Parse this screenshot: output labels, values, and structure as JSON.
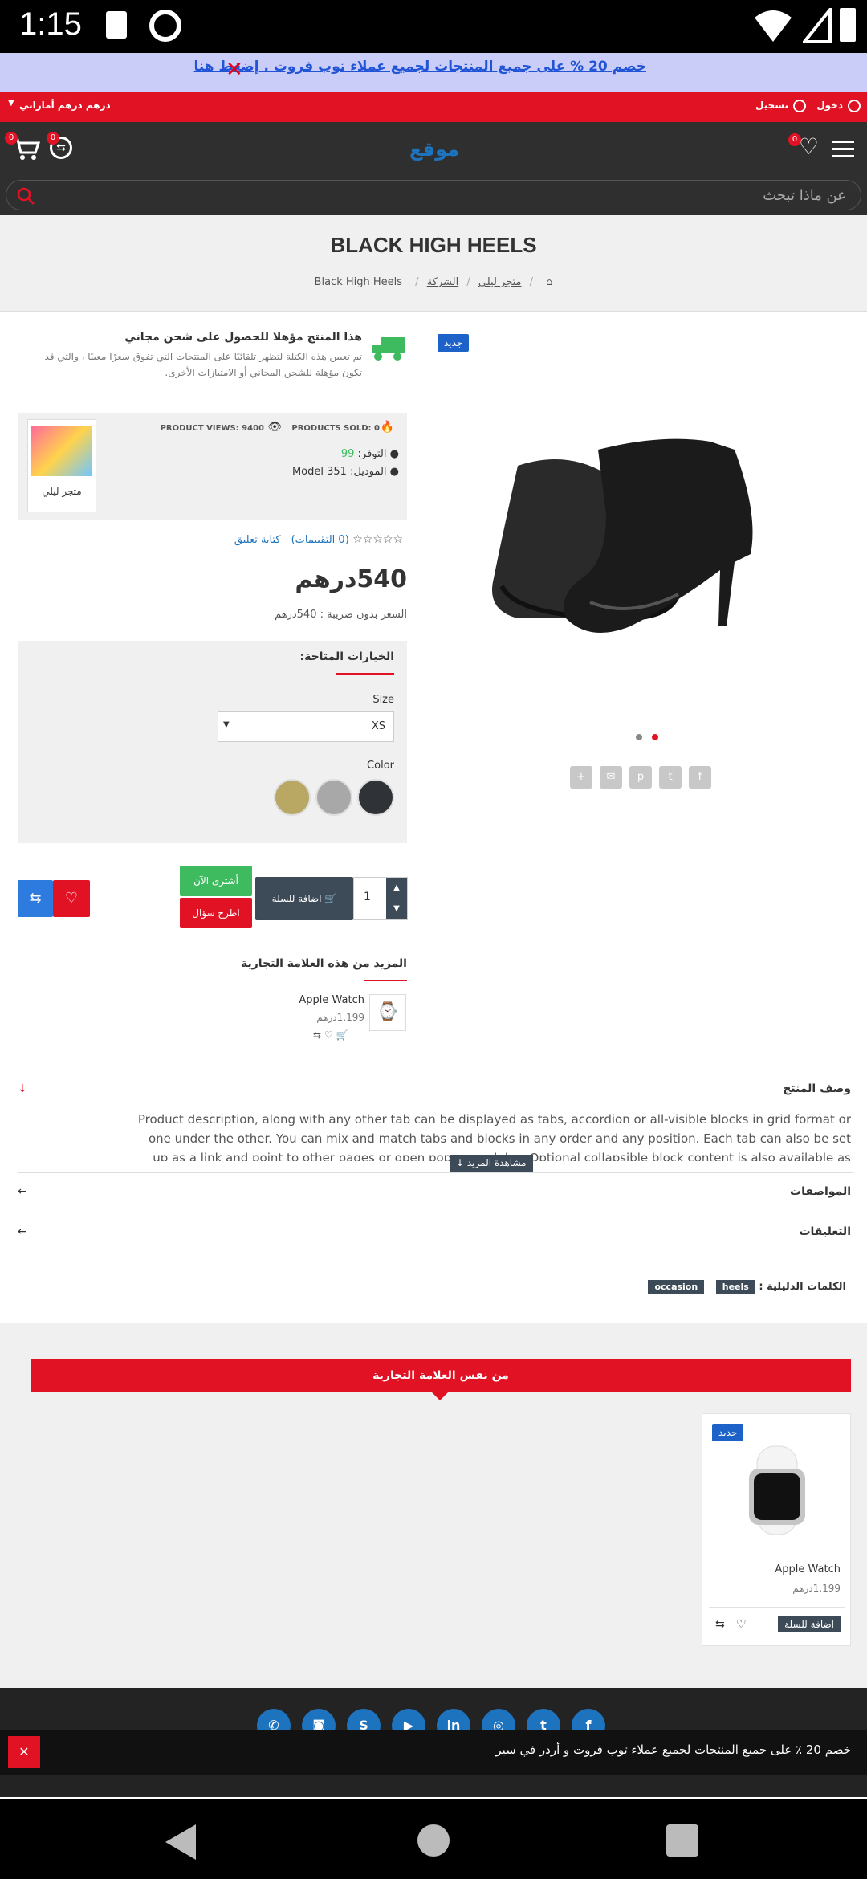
{
  "status_bar": {
    "time": "1:15"
  },
  "promo_bar": {
    "text": "خصم 20 % على جميع المنتجات لجميع عملاء توب فروت . إضغط هنا"
  },
  "top_bar": {
    "login": "دخول",
    "register": "تسجيل",
    "currency": "درهم درهم أماراتي"
  },
  "header": {
    "logo_text": "موقع",
    "wishlist_count": "0",
    "cart_count": "0",
    "compare_count": "0"
  },
  "search": {
    "placeholder": "عن ماذا تبحث"
  },
  "page": {
    "title": "BLACK HIGH HEELS"
  },
  "breadcrumb": {
    "items": [
      "الشركة",
      "متجر ليلي",
      "Black High Heels"
    ]
  },
  "product": {
    "badge_new": "جديد",
    "shipping_title": "هذا المنتج مؤهلا للحصول على شحن مجاني",
    "shipping_desc": "تم تعيين هذه الكتلة لتظهر تلقائيًا على المنتجات التي تفوق سعرًا معينًا ، والتي قد تكون مؤهلة للشحن المجاني أو الامتيازات الأخرى.",
    "products_sold": "PRODUCTS SOLD: 0",
    "product_views": "PRODUCT VIEWS: 9400",
    "availability_label": "التوفر:",
    "availability_value": "99",
    "model_label": "الموديل:",
    "model_value": "Model 351",
    "store_name": "متجر ليلي",
    "reviews": "(0 التقييمات) - كتابة تعليق",
    "price": "540درهم",
    "price_ex_tax": "السعر بدون ضريبة : 540درهم",
    "options_title": "الخيارات المتاحة:",
    "size_label": "Size",
    "size_value": "XS",
    "color_label": "Color",
    "color_swatches": [
      "#b9a764",
      "#a8a8a8",
      "#2f3237"
    ],
    "quantity": "1",
    "add_to_cart": "اضافة للسلة",
    "buy_now": "أشترى الآن",
    "ask_question": "اطرح سؤال",
    "more_brand_title": "المزيد من هذه العلامة التجارية",
    "related": {
      "name": "Apple Watch",
      "price": "1,199درهم"
    }
  },
  "tabs": {
    "description_title": "وصف المنتج",
    "description_text": "Product description, along with any other tab can be displayed as tabs, accordion or all-visible blocks in grid format or one under the other.  You can mix and match tabs and blocks in any order and any position. Each tab can also be set up as a link and point to other pages or open popup modules. Optional collapsible block content is also available as an option for",
    "see_more": "مشاهدة المزيد",
    "specs_title": "المواصفات",
    "comments_title": "التعليقات",
    "tags_label": "الكلمات الدليلية :",
    "tags": [
      "heels",
      "occasion"
    ]
  },
  "same_brand": {
    "title": "من نفس العلامة التجارية",
    "card": {
      "badge": "جديد",
      "name": "Apple Watch",
      "price": "1,199درهم",
      "add_to_cart": "اضافة للسلة"
    }
  },
  "cookie_bar": {
    "text": "خصم 20 ٪ على جميع المنتجات لجميع عملاء توب فروت و أردر في سير"
  },
  "colors": {
    "accent_red": "#e01224",
    "header_dark": "#2f2f2f",
    "blue": "#1d62c9",
    "green": "#3dbb5e"
  }
}
